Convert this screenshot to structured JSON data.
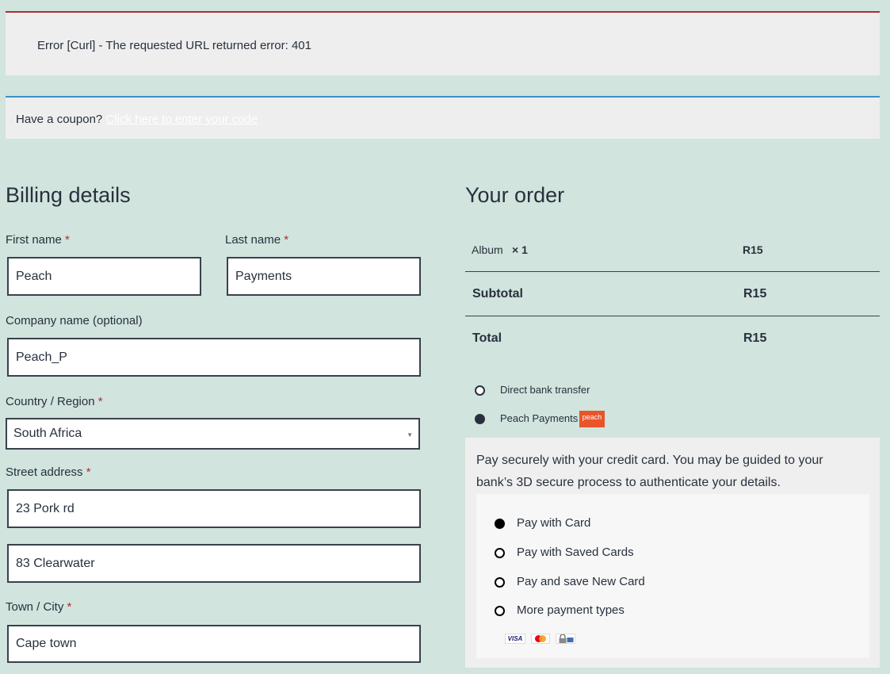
{
  "notices": {
    "error_text": "Error [Curl] - The requested URL returned error: 401",
    "coupon_prompt": "Have a coupon?",
    "coupon_link": "Click here to enter your code"
  },
  "billing": {
    "heading": "Billing details",
    "required_mark": "*",
    "first_name_label": "First name",
    "first_name_value": "Peach",
    "last_name_label": "Last name",
    "last_name_value": "Payments",
    "company_label": "Company name (optional)",
    "company_value": "Peach_P",
    "country_label": "Country / Region",
    "country_value": "South Africa",
    "street_label": "Street address",
    "street_value_1": "23 Pork rd",
    "street_value_2": "83 Clearwater",
    "city_label": "Town / City",
    "city_value": "Cape town"
  },
  "order": {
    "heading": "Your order",
    "item_name": "Album",
    "item_qty": "× 1",
    "item_price": "R15",
    "subtotal_label": "Subtotal",
    "subtotal_value": "R15",
    "total_label": "Total",
    "total_value": "R15"
  },
  "payment": {
    "method_bank": "Direct bank transfer",
    "method_peach": "Peach Payments",
    "peach_logo_text": "peach",
    "description": "Pay securely with your credit card. You may be guided to your bank’s 3D secure process to authenticate your details.",
    "options": [
      "Pay with Card",
      "Pay with Saved Cards",
      "Pay and save New Card",
      "More payment types"
    ],
    "selected_option": "Pay with Card",
    "card_logos": [
      "VISA",
      "mastercard-icon",
      "secure-icon"
    ]
  },
  "colors": {
    "background": "#d1e4dd",
    "error_border": "#b22a33",
    "info_border": "#3b8fc9",
    "peach_brand": "#e9552a"
  }
}
